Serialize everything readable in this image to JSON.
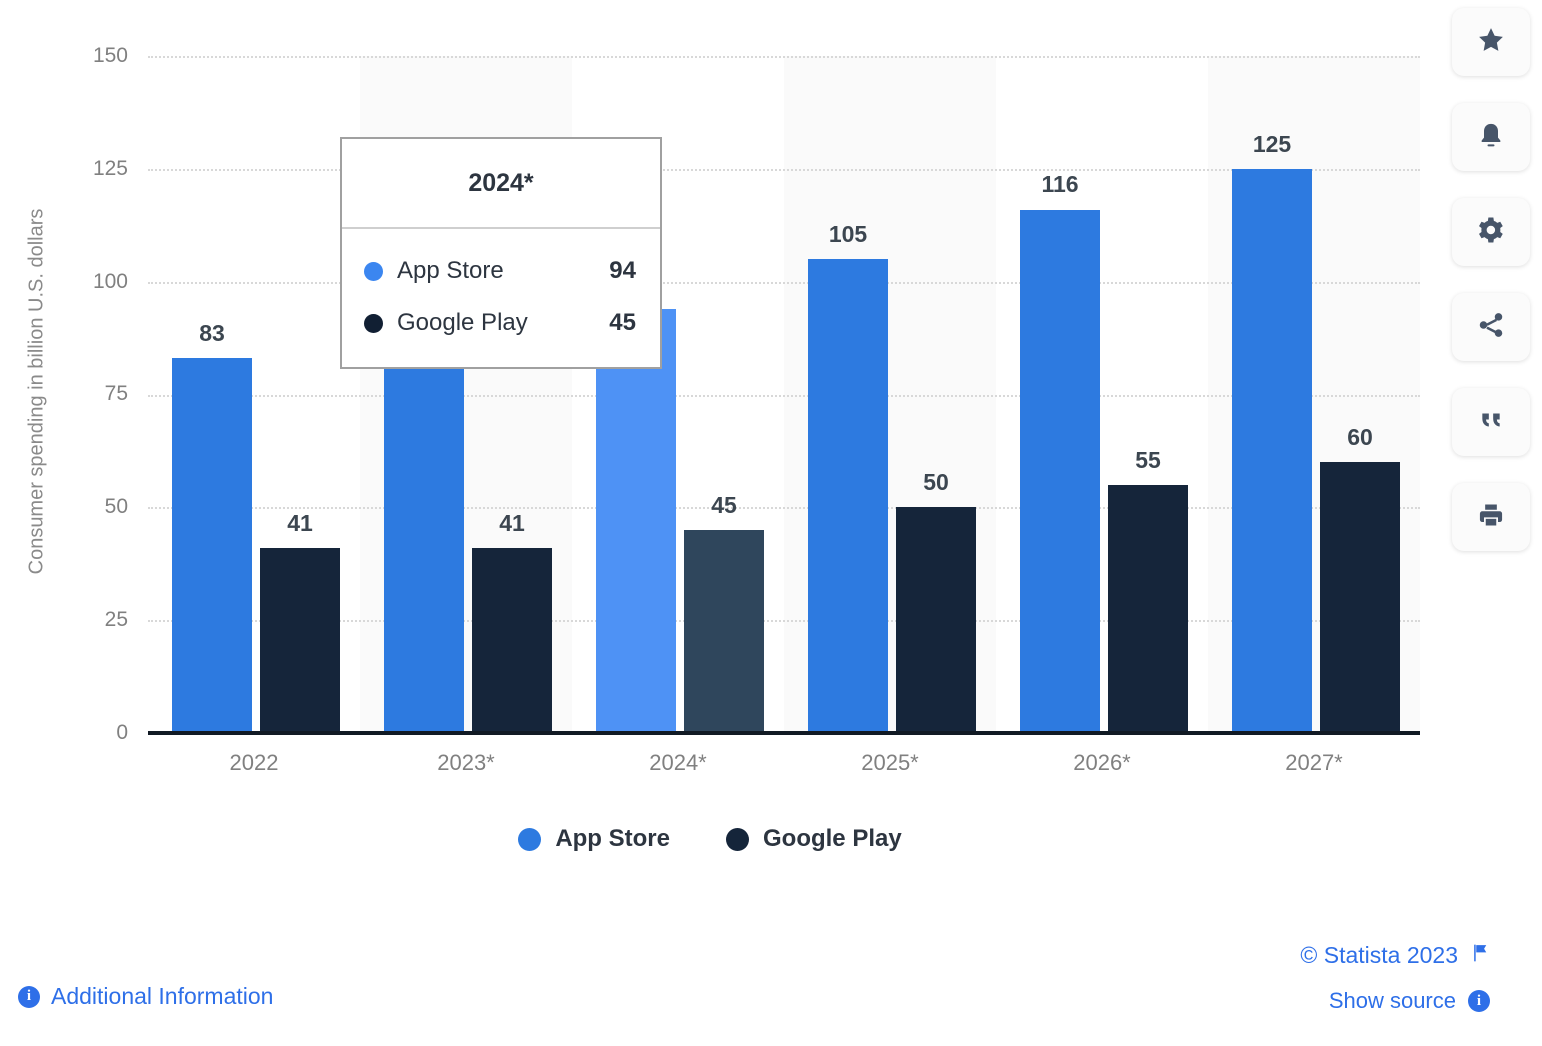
{
  "chart_data": {
    "type": "bar",
    "title": "",
    "xlabel": "",
    "ylabel": "Consumer spending in billion U.S. dollars",
    "ylim": [
      0,
      150
    ],
    "yticks": [
      0,
      25,
      50,
      75,
      100,
      125,
      150
    ],
    "grid": true,
    "legend_position": "bottom",
    "categories": [
      "2022",
      "2023*",
      "2024*",
      "2025*",
      "2026*",
      "2027*"
    ],
    "series": [
      {
        "name": "App Store",
        "color": "#2d7ae0",
        "highlight_color": "#4e92f5",
        "values": [
          83,
          83,
          94,
          105,
          116,
          125
        ]
      },
      {
        "name": "Google Play",
        "color": "#15253a",
        "highlight_color": "#2f465c",
        "values": [
          41,
          41,
          45,
          50,
          55,
          60
        ]
      }
    ],
    "highlighted_category_index": 2
  },
  "tooltip": {
    "title": "2024*",
    "rows": [
      {
        "label": "App Store",
        "value": "94",
        "color": "#3b86f0"
      },
      {
        "label": "Google Play",
        "value": "45",
        "color": "#111f33"
      }
    ]
  },
  "legend": {
    "items": [
      {
        "label": "App Store",
        "color": "#2d7ae0"
      },
      {
        "label": "Google Play",
        "color": "#15253a"
      }
    ]
  },
  "toolbar": {
    "buttons": [
      {
        "icon": "star-icon",
        "name": "favorite-button"
      },
      {
        "icon": "bell-icon",
        "name": "notification-button"
      },
      {
        "icon": "gear-icon",
        "name": "settings-button"
      },
      {
        "icon": "share-icon",
        "name": "share-button"
      },
      {
        "icon": "quote-icon",
        "name": "cite-button"
      },
      {
        "icon": "printer-icon",
        "name": "print-button"
      }
    ]
  },
  "footer": {
    "additional_information": "Additional Information",
    "copyright": "© Statista 2023",
    "show_source": "Show source"
  },
  "colors": {
    "app_store": "#2d7ae0",
    "google_play": "#15253a",
    "link": "#2e6fe8",
    "band": "#fafafa",
    "axis": "#111a24"
  }
}
